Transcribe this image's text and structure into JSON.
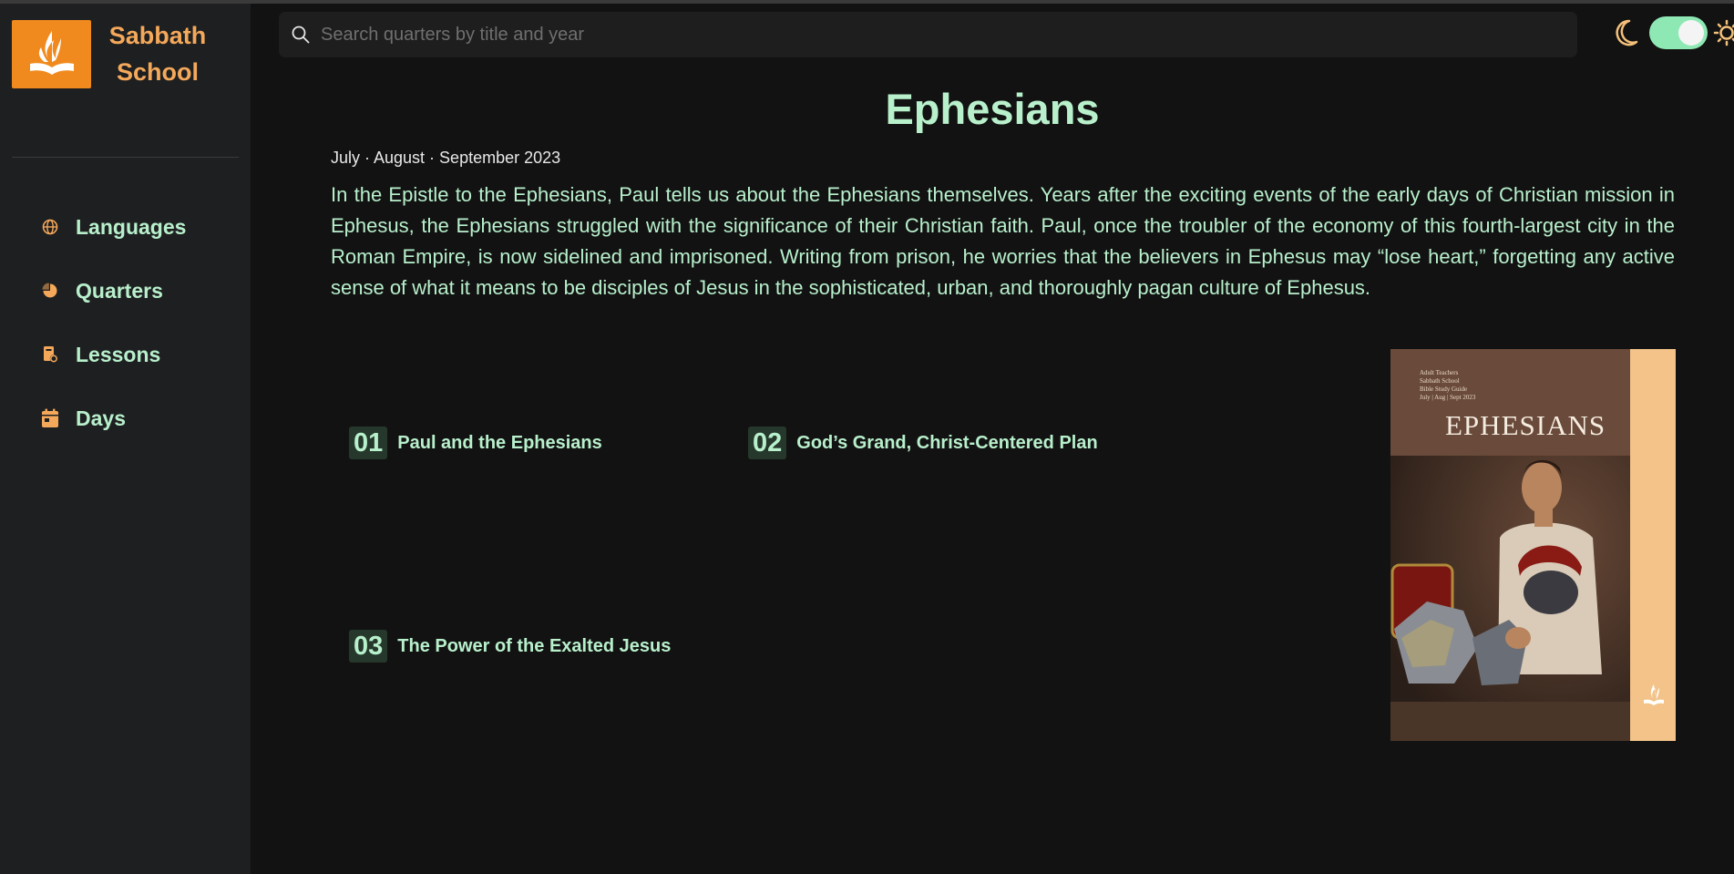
{
  "brand": {
    "line1": "Sabbath",
    "line2": "School",
    "logo_color": "#f08a1e"
  },
  "sidebar": {
    "items": [
      {
        "label": "Languages",
        "icon": "globe-icon"
      },
      {
        "label": "Quarters",
        "icon": "pie-icon"
      },
      {
        "label": "Lessons",
        "icon": "lesson-book-icon"
      },
      {
        "label": "Days",
        "icon": "calendar-icon"
      }
    ]
  },
  "search": {
    "placeholder": "Search quarters by title and year",
    "value": ""
  },
  "theme": {
    "mode": "dark",
    "toggle_on": true,
    "accent": "#8ee8b4"
  },
  "quarter": {
    "title": "Ephesians",
    "dates": "July · August · September 2023",
    "description": "In the Epistle to the Ephesians, Paul tells us about the Ephesians themselves. Years after the exciting events of the early days of Christian mission in Ephesus, the Ephesians struggled with the significance of their Christian faith. Paul, once the troubler of the economy of this fourth-largest city in the Roman Empire, is now sidelined and imprisoned. Writing from prison, he worries that the believers in Ephesus may “lose heart,” forgetting any active sense of what it means to be disciples of Jesus in the sophisticated, urban, and thoroughly pagan culture of Ephesus."
  },
  "lessons": [
    {
      "num": "01",
      "title": "Paul and the Ephesians"
    },
    {
      "num": "02",
      "title": "God’s Grand, Christ-Centered Plan"
    },
    {
      "num": "03",
      "title": "The Power of the Exalted Jesus"
    }
  ],
  "cover": {
    "small_lines": [
      "Adult Teachers",
      "Sabbath School",
      "Bible Study Guide",
      "July | Aug | Sept 2023"
    ],
    "title": "EPHESIANS"
  }
}
